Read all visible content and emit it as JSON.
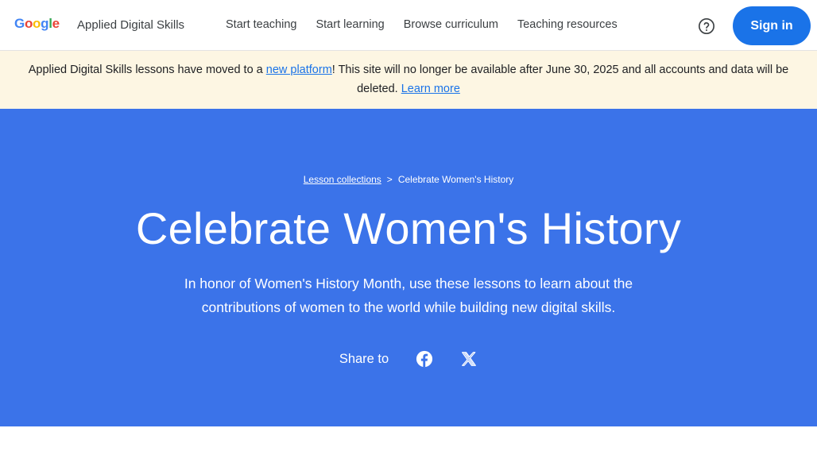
{
  "header": {
    "logo_letters": [
      {
        "char": "G",
        "color": "#4285f4"
      },
      {
        "char": "o",
        "color": "#ea4335"
      },
      {
        "char": "o",
        "color": "#fbbc05"
      },
      {
        "char": "g",
        "color": "#4285f4"
      },
      {
        "char": "l",
        "color": "#34a853"
      },
      {
        "char": "e",
        "color": "#ea4335"
      }
    ],
    "site_name": "Applied Digital Skills",
    "nav": [
      {
        "label": "Start teaching"
      },
      {
        "label": "Start learning"
      },
      {
        "label": "Browse curriculum"
      },
      {
        "label": "Teaching resources"
      }
    ],
    "help_icon": "help-circle-icon",
    "signin_label": "Sign in"
  },
  "banner": {
    "text_before": "Applied Digital Skills lessons have moved to a ",
    "link_platform": "new platform",
    "text_after": "! This site will no longer be available after June 30, 2025 and all accounts and data will be deleted. ",
    "link_learn_more": "Learn more"
  },
  "hero": {
    "breadcrumb": {
      "parent": "Lesson collections",
      "separator": ">",
      "current": "Celebrate Women's History"
    },
    "title": "Celebrate Women's History",
    "description": "In honor of Women's History Month, use these lessons to learn about the contributions of women to the world while building new digital skills.",
    "share_label": "Share to",
    "share_icons": [
      "facebook-icon",
      "x-icon"
    ]
  },
  "colors": {
    "brand_blue": "#1a73e8",
    "hero_bg": "#3b73e9",
    "banner_bg": "#fdf6e3"
  }
}
